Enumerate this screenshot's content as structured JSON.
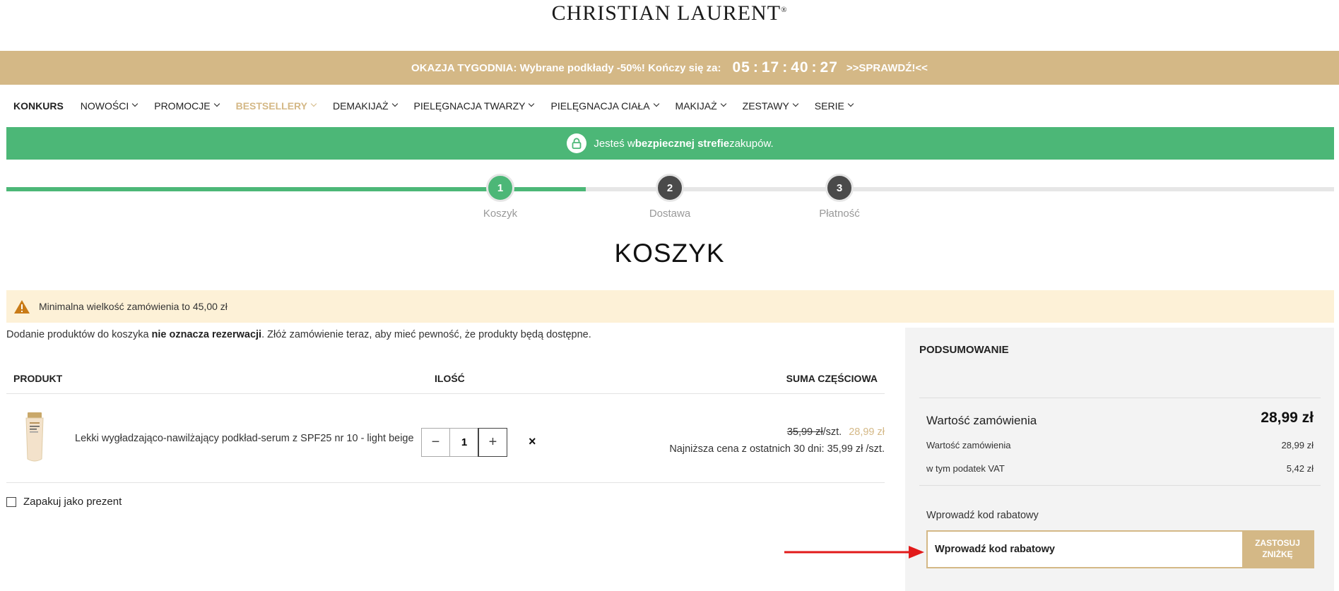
{
  "brand": {
    "logo": "CHRISTIAN LAURENT",
    "reg": "®"
  },
  "promo": {
    "text": "OKAZJA TYGODNIA: Wybrane podkłady -50%! Kończy się za:",
    "timer": [
      "05",
      "17",
      "40",
      "27"
    ],
    "link": ">>SPRAWDŹ!<<"
  },
  "nav": {
    "items": [
      {
        "label": "KONKURS"
      },
      {
        "label": "NOWOŚCI"
      },
      {
        "label": "PROMOCJE"
      },
      {
        "label": "BESTSELLERY"
      },
      {
        "label": "DEMAKIJAŻ"
      },
      {
        "label": "PIELĘGNACJA TWARZY"
      },
      {
        "label": "PIELĘGNACJA CIAŁA"
      },
      {
        "label": "MAKIJAŻ"
      },
      {
        "label": "ZESTAWY"
      },
      {
        "label": "SERIE"
      }
    ]
  },
  "secure": {
    "pre": "Jesteś w ",
    "bold": "bezpiecznej strefie",
    "post": " zakupów."
  },
  "steps": [
    {
      "num": "1",
      "label": "Koszyk"
    },
    {
      "num": "2",
      "label": "Dostawa"
    },
    {
      "num": "3",
      "label": "Płatność"
    }
  ],
  "title": "KOSZYK",
  "warning": "Minimalna wielkość zamówienia to 45,00 zł",
  "notice": {
    "pre": "Dodanie produktów do koszyka ",
    "bold": "nie oznacza rezerwacji",
    "post": ". Złóż zamówienie teraz, aby mieć pewność, że produkty będą dostępne."
  },
  "table": {
    "col_product": "PRODUKT",
    "col_qty": "ILOŚĆ",
    "col_sum": "SUMA CZĘŚCIOWA"
  },
  "item": {
    "name": "Lekki wygładzająco-nawilżający podkład-serum z SPF25 nr 10 - light beige",
    "qty": "1",
    "old_price": "35,99 zł",
    "unit": "/szt.",
    "new_price": "28,99 zł",
    "lowest": "Najniższa cena z ostatnich 30 dni: 35,99 zł /szt."
  },
  "gift": "Zapakuj jako prezent",
  "summary": {
    "title": "PODSUMOWANIE",
    "total_label": "Wartość zamówienia",
    "total_value": "28,99 zł",
    "line1_label": "Wartość zamówienia",
    "line1_value": "28,99 zł",
    "line2_label": "w tym podatek VAT",
    "line2_value": "5,42 zł",
    "coupon_label": "Wprowadź kod rabatowy",
    "coupon_placeholder": "Wprowadź kod rabatowy",
    "coupon_button_line1": "ZASTOSUJ",
    "coupon_button_line2": "ZNIŻKĘ"
  },
  "colors": {
    "gold": "#d4b886",
    "green": "#4cb777",
    "warning_bg": "#fdf1d7",
    "arrow": "#e21a1a"
  }
}
